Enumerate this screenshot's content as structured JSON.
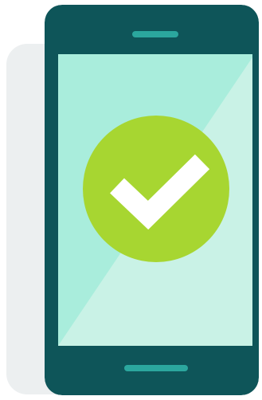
{
  "illustration": {
    "icons": [
      "smartphone-icon",
      "checkmark-icon"
    ],
    "colors": {
      "phone": "#0e5559",
      "speaker": "#2ba79e",
      "screen_light": "#c9f2e6",
      "screen_main": "#a9eddc",
      "check_circle": "#a7d631",
      "check_mark": "#ffffff",
      "shadow": "#eceff0"
    }
  }
}
